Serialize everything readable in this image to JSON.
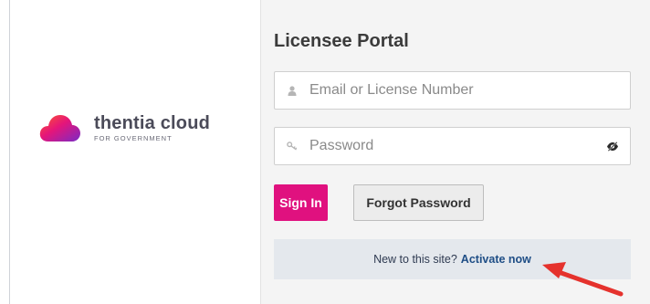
{
  "brand": {
    "name": "thentia cloud",
    "subtitle": "FOR GOVERNMENT"
  },
  "portal": {
    "title": "Licensee Portal"
  },
  "login_form": {
    "email_placeholder": "Email or License Number",
    "password_placeholder": "Password",
    "sign_in_label": "Sign In",
    "forgot_password_label": "Forgot Password"
  },
  "activation": {
    "prompt": "New to this site?",
    "link_label": "Activate now"
  },
  "icons": {
    "email_field": "user-icon",
    "password_field": "key-icon",
    "password_toggle": "eye-slash-icon",
    "annotation": "red-arrow-icon"
  },
  "colors": {
    "accent": "#e0117f",
    "link": "#1f4e86",
    "annotation_arrow": "#e5322d"
  }
}
